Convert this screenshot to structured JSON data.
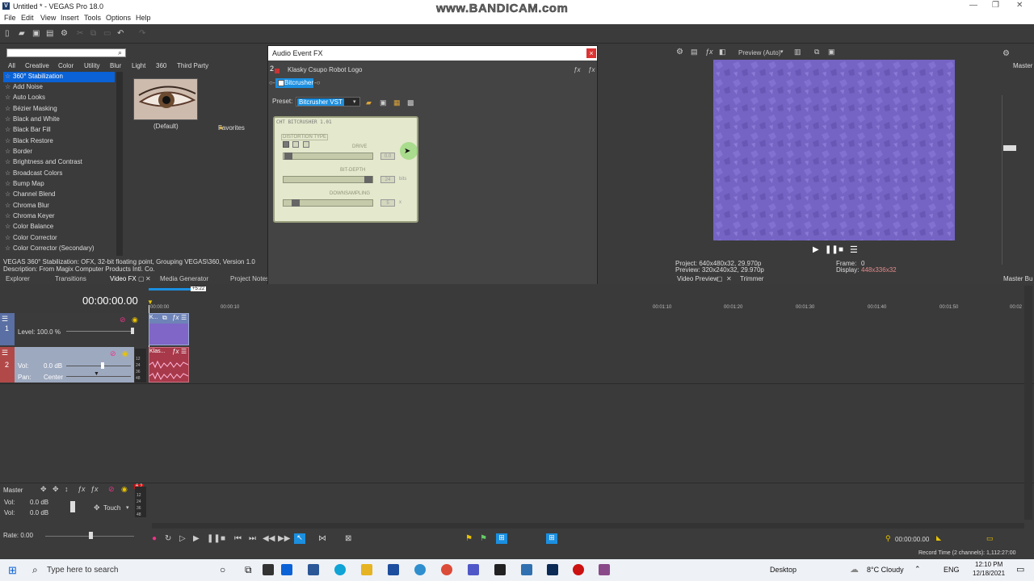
{
  "titlebar": {
    "title": "Untitled * - VEGAS Pro 18.0",
    "logo": "V",
    "watermark": "www.BANDICAM.com"
  },
  "menu": [
    "File",
    "Edit",
    "View",
    "Insert",
    "Tools",
    "Options",
    "Help"
  ],
  "fx_panel": {
    "tabs": [
      "All",
      "Creative",
      "Color",
      "Utility",
      "Blur",
      "Light",
      "360",
      "Third Party",
      "Favorites"
    ],
    "items": [
      "360° Stabilization",
      "Add Noise",
      "Auto Looks",
      "Bézier Masking",
      "Black and White",
      "Black Bar Fill",
      "Black Restore",
      "Border",
      "Brightness and Contrast",
      "Broadcast Colors",
      "Bump Map",
      "Channel Blend",
      "Chroma Blur",
      "Chroma Keyer",
      "Color Balance",
      "Color Corrector",
      "Color Corrector (Secondary)"
    ],
    "preset_label": "(Default)",
    "description_1": "VEGAS 360° Stabilization: OFX, 32-bit floating point, Grouping VEGAS\\360, Version 1.0",
    "description_2": "Description: From Magix Computer Products Intl. Co."
  },
  "bottom_tabs": [
    "Explorer",
    "Transitions",
    "Video FX",
    "Media Generator",
    "Project Notes"
  ],
  "dialog": {
    "title": "Audio Event FX",
    "track_num": "2",
    "event_name": "Klasky Csupo Robot Logo",
    "chain_item": "Bitcrusher",
    "preset_label": "Preset:",
    "preset_value": "Bitcrusher VST",
    "close": "×",
    "plugin": {
      "title": "CHT BITCRUSHER 1.01",
      "distortion_type": "DISTORTION TYPE",
      "drive_label": "DRIVE",
      "drive_value": "0.0",
      "bitdepth_label": "BIT-DEPTH",
      "bitdepth_value": "24",
      "bitdepth_unit": "bits",
      "downsampling_label": "DOWNSAMPLING",
      "downsampling_value": "5",
      "downsampling_unit": "x"
    }
  },
  "preview_panel": {
    "mode": "Preview (Auto)",
    "project": "Project:  640x480x32, 29.970p",
    "preview": "Preview:  320x240x32, 29.970p",
    "frame_label": "Frame:",
    "frame_value": "0",
    "display_label": "Display:",
    "display_value": "448x336x32",
    "tabs": [
      "Video Preview",
      "Trimmer"
    ],
    "master_label": "Master",
    "master_bus": "Master Bu"
  },
  "timeline": {
    "timecode": "00:00:00.00",
    "marker": "+5:22",
    "ruler": [
      "00:00:00",
      "00:00:10",
      "00:01:10",
      "00:01:20",
      "00:01:30",
      "00:01:40",
      "00:01:50",
      "00:02"
    ],
    "track1": {
      "num": "1",
      "level": "Level: 100.0 %",
      "clip": "K..."
    },
    "track2": {
      "num": "2",
      "vol_label": "Vol:",
      "vol": "0.0 dB",
      "pan_label": "Pan:",
      "pan": "Center",
      "clip": "Klas...",
      "meter": [
        "12",
        "24",
        "36",
        "48"
      ]
    }
  },
  "master": {
    "label": "Master",
    "vol1_label": "Vol:",
    "vol1": "0.0 dB",
    "vol2_label": "Vol:",
    "vol2": "0.0 dB",
    "touch": "Touch",
    "level": "6.2",
    "meter": [
      "12",
      "24",
      "36",
      "48"
    ],
    "rate": "Rate: 0.00"
  },
  "transport": {
    "time": "00:00:00.00",
    "record_time": "Record Time (2 channels): 1,112:27:00"
  },
  "taskbar": {
    "search": "Type here to search",
    "desktop": "Desktop",
    "weather": "8°C  Cloudy",
    "lang": "ENG",
    "time": "12:10 PM",
    "date": "12/18/2021"
  },
  "colors": {
    "accent": "#0a62d6",
    "preview_fill": "#7a67c9",
    "video_track": "#6e83b7",
    "audio_track": "#9da9bf"
  }
}
